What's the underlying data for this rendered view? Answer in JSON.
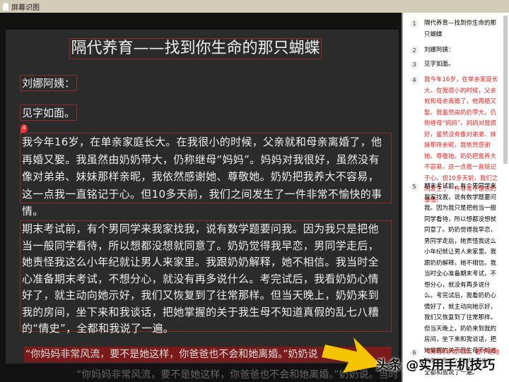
{
  "window": {
    "title": "屏幕识图"
  },
  "doc": {
    "title": "隔代养育——找到你生命的那只蝴蝶",
    "line1": "刘娜阿姨：",
    "line2": "见字如面。",
    "marker": "4",
    "para4": "我今年16岁，在单亲家庭长大。在我很小的时候，父亲就和母亲离婚了，他再婚又娶。我虽然由奶奶带大，仍称继母“妈妈”。妈妈对我很好，虽然没有像对弟弟、妹妹那样亲昵，我依然感谢她、尊敬她。奶奶把我养大不容易，这一点我一直铭记于心。但10多天前，我们之间发生了一件非常不愉快的事情。",
    "para5": "期末考试前，有个男同学来我家找我，说有数学题要问我。因为我只是把他当一般同学看待，所以想都没想就同意了。奶奶觉得我早恋，男同学走后，她责怪我这么小年纪就让男人来家里。我跟奶奶解释，她不相信。我当时全心准备期末考试，不想分心，就没有再多说什么。考完试后，我看奶奶心情好了，就主动向她示好，我们又恢复到了往常那样。但当天晚上，奶奶来到我的房间，坐下来和我谈话，把她掌握的关于我生母不知道真假的乱七八糟的“情史”，全都和我说了一遍。",
    "quote": "“你妈妈非常风流，要不是她这样，你爸爸也不会和她离婚。”奶奶说",
    "under": "“你妈妈非常风流，要不是她这样，你爸爸也不会和她离婚。”奶奶说。当时"
  },
  "sidebar": {
    "items": [
      {
        "num": "1",
        "text": "隔代养育—找到你生命的那只蝴蝶"
      },
      {
        "num": "2",
        "text": "刘娜阿姨："
      },
      {
        "num": "3",
        "text": "见字如面。"
      },
      {
        "num": "4",
        "text": "我今年16岁，在单亲家庭长大。在我很小的时候，父亲就和母亲离婚了，他再婚又娶。我虽然由奶奶带大，仍称继母“妈妈”。妈妈对我很好，虽然没有像对弟弟、妹妹那样亲昵，我依然感谢她、尊敬她。奶奶把我养大不容易，这一点我一直铭记于心。但10多天前，我们之间发生了一件非常不愉快的事情。"
      },
      {
        "num": "5",
        "text": "期末考试前，有个男同学来我家找我，说有数学题要问我。因为我只是把他当一般同学看待，所以想都没想就同意了。奶奶觉得我早恋，男同学走后，她责怪我这么小年纪就让男人来家里。我跟奶奶解释，她不相信。我当时全心准备期末考试，不想分心，就没有再多说什么。考完试后，我看奶奶心情好了，就主动向她示好，我们又恢复到了往常那样。但当天晚上，奶奶来到我的房间，坐下来和我谈话，把她掌握的关于我生母不知道真假的乱七八糟的“情史”，全都和我说了一遍。"
      },
      {
        "num": "6",
        "text": "“你妈妈非常风流，要不是她这"
      }
    ]
  },
  "watermark": "头条 @实用手机技巧"
}
